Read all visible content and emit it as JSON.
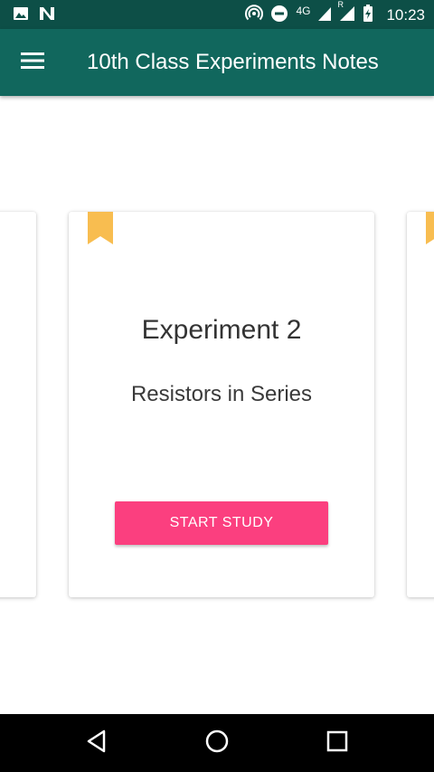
{
  "status_bar": {
    "network": "4G",
    "roaming": "R",
    "time": "10:23",
    "icons": [
      "image-icon",
      "n-app-icon",
      "hotspot-icon",
      "dnd-icon",
      "signal-icon",
      "signal-roaming-icon",
      "battery-charging-icon"
    ]
  },
  "app_bar": {
    "title": "10th Class Experiments Notes",
    "menu_icon": "hamburger-menu-icon",
    "color": "#11675d"
  },
  "carousel": {
    "current": {
      "title": "Experiment 2",
      "subtitle": "Resistors in Series",
      "button_label": "START STUDY",
      "bookmark_icon": "bookmark-icon",
      "bookmark_color": "#f8bd50",
      "button_color": "#fb3f7f"
    }
  },
  "nav_bar": {
    "icons": [
      "back-icon",
      "home-icon",
      "recents-icon"
    ]
  }
}
